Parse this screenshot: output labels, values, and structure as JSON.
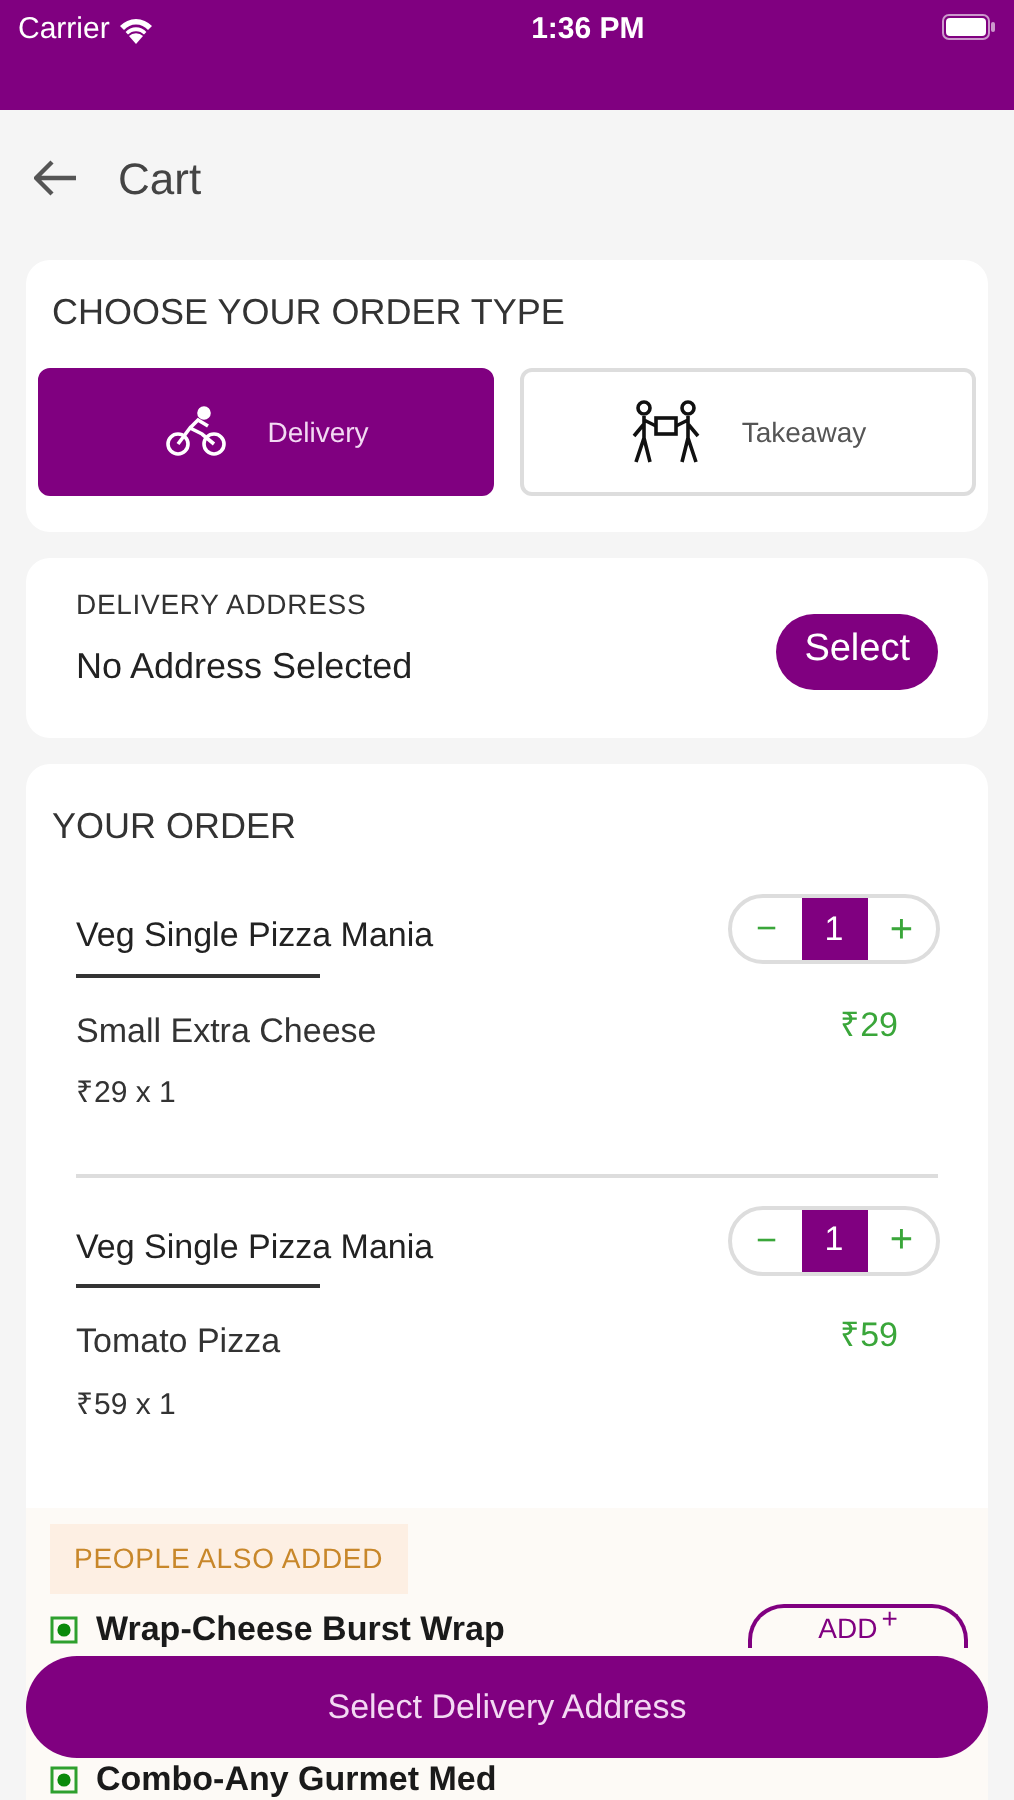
{
  "status_bar": {
    "carrier": "Carrier",
    "time": "1:36 PM"
  },
  "header": {
    "title": "Cart"
  },
  "order_type": {
    "title": "CHOOSE YOUR ORDER TYPE",
    "options": [
      {
        "kind": "delivery",
        "label": "Delivery",
        "selected": true
      },
      {
        "kind": "takeaway",
        "label": "Takeaway",
        "selected": false
      }
    ]
  },
  "address": {
    "label": "DELIVERY ADDRESS",
    "value": "No Address Selected",
    "button": "Select"
  },
  "order": {
    "title": "YOUR ORDER",
    "items": [
      {
        "name": "Veg Single Pizza Mania",
        "minus": "−",
        "quantity": "1",
        "plus": "+",
        "variant": "Small Extra Cheese",
        "unit": "₹29 x 1",
        "price": "₹29"
      },
      {
        "name": "Veg Single Pizza Mania",
        "minus": "−",
        "quantity": "1",
        "plus": "+",
        "variant": "Tomato Pizza",
        "unit": "₹59 x 1",
        "price": "₹59"
      }
    ]
  },
  "suggestions": {
    "title": "PEOPLE ALSO ADDED",
    "items": [
      {
        "name": "Wrap-Cheese Burst Wrap",
        "add": "ADD",
        "plus": "+"
      },
      {
        "name": "Combo-Any Gurmet Med"
      }
    ]
  },
  "footer_button": "Select Delivery Address"
}
